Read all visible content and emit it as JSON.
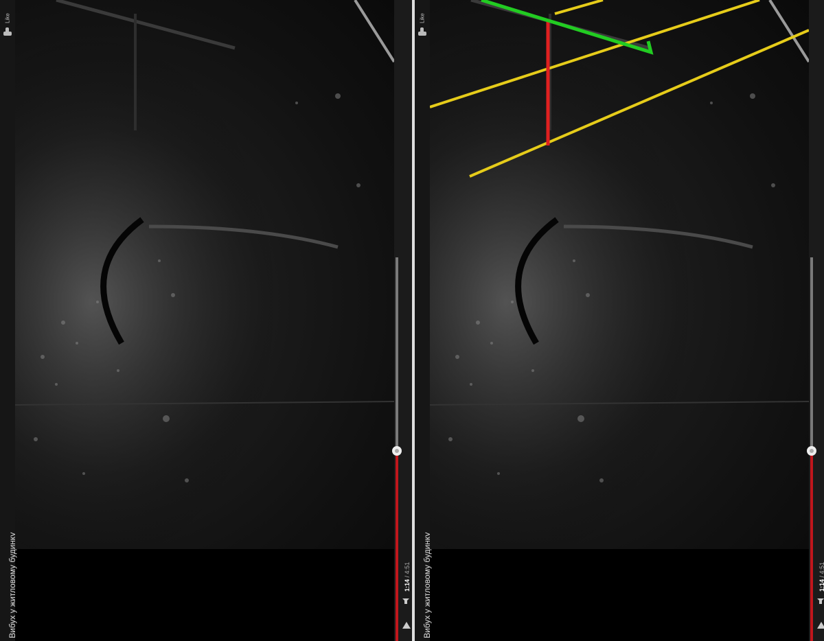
{
  "panels": [
    {
      "id": "left",
      "like_label": "Like",
      "video_title": "Вибух у житловому будинку",
      "time": {
        "current": "1:14",
        "separator": "/",
        "total": "4:51"
      },
      "progress_fraction": 0.254,
      "annotated": false
    },
    {
      "id": "right",
      "like_label": "Like",
      "video_title": "Вибух у житловому будинку",
      "time": {
        "current": "1:14",
        "separator": "/",
        "total": "4:51"
      },
      "progress_fraction": 0.254,
      "annotated": true
    }
  ],
  "colors": {
    "progress_played": "#c0161c",
    "annotation_yellow": "#e6cc1a",
    "annotation_red": "#e02020",
    "annotation_green": "#22cc22"
  },
  "icons": [
    "like-thumb-icon",
    "volume-icon",
    "play-icon",
    "scrub-handle"
  ]
}
